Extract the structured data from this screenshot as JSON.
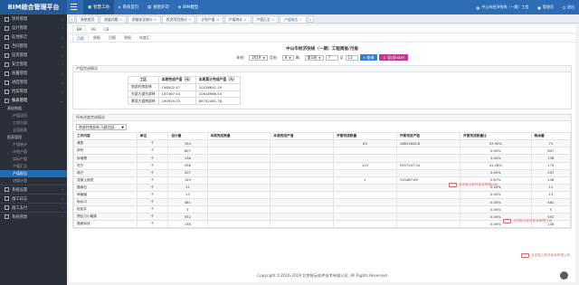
{
  "topbar": {
    "brand": "BIM综合管理平台",
    "nav": [
      {
        "label": "智慧工地",
        "active": true
      },
      {
        "label": "系统首页"
      },
      {
        "label": "规划许可"
      },
      {
        "label": "BIM模型"
      }
    ],
    "right": [
      {
        "label": "中山市经济快线（一期）工程",
        "icon": "building-icon"
      },
      {
        "label": "管理员",
        "icon": "user-icon"
      },
      {
        "label": "退出",
        "icon": "logout-icon"
      }
    ]
  },
  "sidebar": [
    {
      "label": "项目管理",
      "level": 1
    },
    {
      "label": "设计管理",
      "level": 1
    },
    {
      "label": "征地拆迁",
      "level": 1
    },
    {
      "label": "合同管理",
      "level": 1
    },
    {
      "label": "投资管理",
      "level": 1
    },
    {
      "label": "安全管理",
      "level": 1
    },
    {
      "label": "质量管理",
      "level": 1
    },
    {
      "label": "进度管理",
      "level": 1
    },
    {
      "label": "档案管理",
      "level": 1
    },
    {
      "label": "报表管理",
      "level": 1,
      "open": true
    },
    {
      "label": "基础数据",
      "level": 2
    },
    {
      "label": "产值项目",
      "level": 3
    },
    {
      "label": "工程分部",
      "level": 3
    },
    {
      "label": "全面报表",
      "level": 3
    },
    {
      "label": "报表管理",
      "level": 2
    },
    {
      "label": "产值统计",
      "level": 3
    },
    {
      "label": "计划产值",
      "level": 3
    },
    {
      "label": "实际产值",
      "level": 3
    },
    {
      "label": "产值汇总",
      "level": 3
    },
    {
      "label": "产值报告",
      "level": 3,
      "active": true
    },
    {
      "label": "进度计量",
      "level": 3
    },
    {
      "label": "系统设置",
      "level": 1
    },
    {
      "label": "施工日志",
      "level": 1
    },
    {
      "label": "施工支付",
      "level": 1
    },
    {
      "label": "系统管理",
      "level": 1
    }
  ],
  "tabs": [
    {
      "label": "系统首页"
    },
    {
      "label": "质量问题"
    },
    {
      "label": "质量安全统计"
    },
    {
      "label": "投资项目统计"
    },
    {
      "label": "计划产值"
    },
    {
      "label": "产值统计"
    },
    {
      "label": "产值汇总"
    },
    {
      "label": "产值报告",
      "active": true
    }
  ],
  "subtabs1": [
    {
      "label": "BA",
      "active": true
    },
    {
      "label": "AB"
    },
    {
      "label": "CB"
    }
  ],
  "subtabs2": [
    {
      "label": "月报",
      "active": true
    },
    {
      "label": "周报"
    },
    {
      "label": "月报"
    },
    {
      "label": "季报"
    },
    {
      "label": "年度汇"
    }
  ],
  "report_title": "中山市经济快线（一期）工程周报/月报",
  "filters": {
    "year_label": "年份：",
    "year": "2019",
    "month_label": "月份：",
    "month": "8",
    "week_label": "周：",
    "week": "第1周",
    "date_from": "7",
    "date_sep": "至",
    "date_to": "13",
    "query_label": "查询",
    "export_label": "导出Excel"
  },
  "summary": {
    "heading": "产值完成情况",
    "columns": [
      "工区",
      "本周完成产值（元）",
      "本周累计完成产值（元）"
    ],
    "rows": [
      [
        "南部村南部林",
        "146002.47",
        "20226641.19"
      ],
      [
        "东部大道东部林",
        "187467.54",
        "10618986.54"
      ],
      [
        "景观大道南部林",
        "190920.03",
        "89742481.78"
      ]
    ]
  },
  "detail": {
    "heading": "所有进度完成情况",
    "selector": "南部村南部林,马路北园..",
    "columns": [
      "工作内容",
      "单位",
      "设计量",
      "本周完成数量",
      "本周完成产值",
      "开累完成数量",
      "开累完成产值",
      "开累完成数量比",
      "剩余量"
    ],
    "rows": [
      [
        "清表",
        "个",
        "154",
        "",
        "",
        "83",
        "16851828.8",
        "53.90%",
        "71"
      ],
      [
        "拆除",
        "个",
        "607",
        "",
        "",
        "",
        "",
        "0.00%",
        "607"
      ],
      [
        "拆墙基",
        "个",
        "138",
        "",
        "",
        "",
        "",
        "0.00%",
        "138"
      ],
      [
        "挖方",
        "个",
        "298",
        "",
        "",
        "123",
        "9257207.24",
        "41.28%",
        "175"
      ],
      [
        "填方",
        "个",
        "207",
        "",
        "",
        "",
        "",
        "0.00%",
        "207"
      ],
      [
        "混凝土面层",
        "个",
        "149",
        "",
        "",
        "1",
        "315487.89",
        "0.67%",
        "148"
      ],
      [
        "路缘石",
        "个",
        "11",
        "",
        "",
        "",
        "",
        "0.00%",
        "11"
      ],
      [
        "伸缩缝",
        "个",
        "13",
        "",
        "",
        "",
        "",
        "0.00%",
        "13"
      ],
      [
        "雨水口",
        "个",
        "481",
        "",
        "",
        "",
        "",
        "0.00%",
        "481"
      ],
      [
        "检查井",
        "个",
        "5",
        "",
        "",
        "",
        "",
        "0.00%",
        "5"
      ],
      [
        "预应力小箱梁",
        "个",
        "552",
        "",
        "",
        "",
        "",
        "0.00%",
        "552"
      ],
      [
        "路面标线",
        "个",
        "138",
        "",
        "",
        "",
        "",
        "0.00%",
        "138"
      ]
    ]
  },
  "footer": "Copyright ©2016-2019 北京智云软件技术有限公司, All Rights Reserved",
  "watermark": {
    "cn": "北京智云软件技术有限公司",
    "en": "Beijing ZhiYun Software Technology Co.,Ltd"
  },
  "colors": {
    "brand": "#2d6db5",
    "sidebar": "#2b2f38",
    "active": "#1f6bb5",
    "export": "#c0398f"
  }
}
